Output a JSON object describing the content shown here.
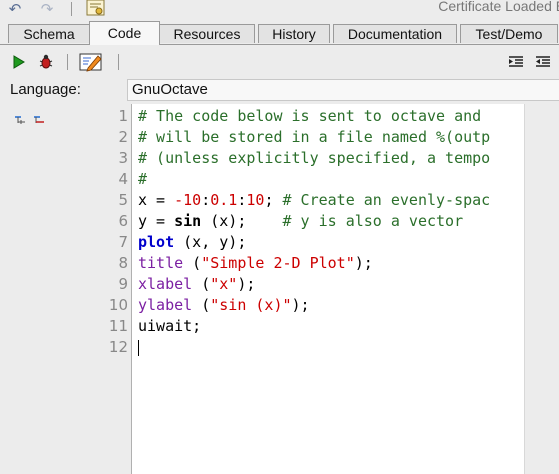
{
  "status": {
    "certificate": "Certificate Loaded E:"
  },
  "tabs": [
    {
      "label": "Schema"
    },
    {
      "label": "Code"
    },
    {
      "label": "Resources"
    },
    {
      "label": "History"
    },
    {
      "label": "Documentation"
    },
    {
      "label": "Test/Demo"
    }
  ],
  "language": {
    "label": "Language:",
    "value": "GnuOctave"
  },
  "editor": {
    "line_numbers": [
      "1",
      "2",
      "3",
      "4",
      "5",
      "6",
      "7",
      "8",
      "9",
      "10",
      "11",
      "12"
    ],
    "lines": [
      [
        {
          "t": "# The code below is sent to octave and",
          "c": "cm"
        }
      ],
      [
        {
          "t": "# will be stored in a file named %(outp",
          "c": "cm"
        }
      ],
      [
        {
          "t": "# (unless explicitly specified, a tempo",
          "c": "cm"
        }
      ],
      [
        {
          "t": "#",
          "c": "cm"
        }
      ],
      [
        {
          "t": "x = ",
          "c": "pl"
        },
        {
          "t": "-10",
          "c": "num"
        },
        {
          "t": ":",
          "c": "pl"
        },
        {
          "t": "0.1",
          "c": "num"
        },
        {
          "t": ":",
          "c": "pl"
        },
        {
          "t": "10",
          "c": "num"
        },
        {
          "t": "; ",
          "c": "pl"
        },
        {
          "t": "# Create an evenly-spac",
          "c": "cm"
        }
      ],
      [
        {
          "t": "y = ",
          "c": "pl"
        },
        {
          "t": "sin",
          "c": "bold"
        },
        {
          "t": " (x);    ",
          "c": "pl"
        },
        {
          "t": "# y is also a vector",
          "c": "cm"
        }
      ],
      [
        {
          "t": "plot",
          "c": "kw"
        },
        {
          "t": " (x, y);",
          "c": "pl"
        }
      ],
      [
        {
          "t": "title",
          "c": "fn"
        },
        {
          "t": " (",
          "c": "pl"
        },
        {
          "t": "\"Simple 2-D Plot\"",
          "c": "str"
        },
        {
          "t": ");",
          "c": "pl"
        }
      ],
      [
        {
          "t": "xlabel",
          "c": "fn"
        },
        {
          "t": " (",
          "c": "pl"
        },
        {
          "t": "\"x\"",
          "c": "str"
        },
        {
          "t": ");",
          "c": "pl"
        }
      ],
      [
        {
          "t": "ylabel",
          "c": "fn"
        },
        {
          "t": " (",
          "c": "pl"
        },
        {
          "t": "\"sin (x)\"",
          "c": "str"
        },
        {
          "t": ");",
          "c": "pl"
        }
      ],
      [
        {
          "t": "uiwait;",
          "c": "pl"
        }
      ],
      []
    ]
  },
  "icons": {
    "undo": "undo-icon",
    "redo": "redo-icon",
    "certificate": "certificate-icon",
    "run": "run-icon",
    "debug": "debug-bug-icon",
    "edit": "edit-script-icon",
    "indent": "indent-icon",
    "outdent": "outdent-icon",
    "expand_all": "expand-all-icon",
    "collapse_all": "collapse-all-icon"
  },
  "colors": {
    "comment": "#2b6f2b",
    "keyword": "#0000cc",
    "function": "#7b1fa2",
    "literal": "#cc0000"
  }
}
